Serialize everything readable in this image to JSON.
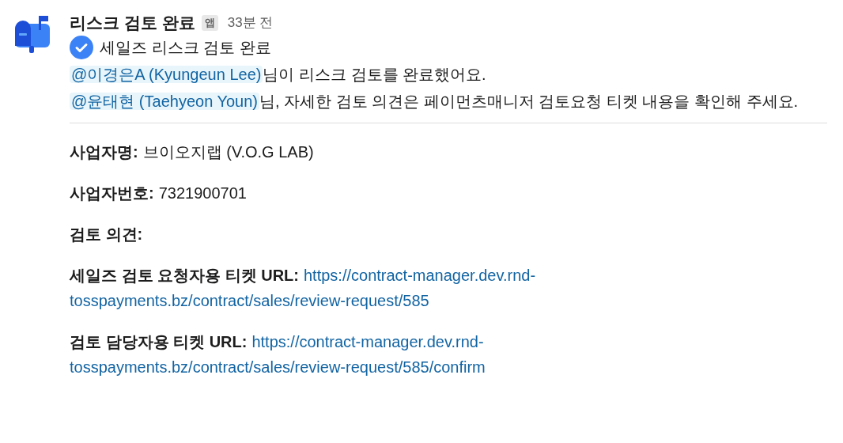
{
  "message": {
    "sender": "리스크 검토 완료",
    "badge": "앱",
    "time": "33분 전",
    "status": {
      "text": "세일즈 리스크 검토 완료"
    },
    "lines": [
      {
        "mention": "@이경은A (Kyungeun Lee)",
        "text": "님이 리스크 검토를 완료했어요."
      },
      {
        "mention": "@윤태현 (Taehyeon Youn)",
        "text": "님, 자세한 검토 의견은 페이먼츠매니저 검토요청 티켓 내용을 확인해 주세요."
      }
    ],
    "fields": [
      {
        "kind": "text",
        "label": "사업자명:",
        "value": "브이오지랩 (V.O.G LAB)"
      },
      {
        "kind": "text",
        "label": "사업자번호:",
        "value": "7321900701"
      },
      {
        "kind": "empty",
        "label": "검토 의견:"
      },
      {
        "kind": "link",
        "label": "세일즈 검토 요청자용 티켓 URL:",
        "value_lines": [
          "https://contract-manager.dev.rnd-",
          "tosspayments.bz/contract/sales/review-request/585"
        ]
      },
      {
        "kind": "link",
        "label": "검토 담당자용 티켓 URL:",
        "value_lines": [
          "https://contract-manager.dev.rnd-",
          "tosspayments.bz/contract/sales/review-request/585/confirm"
        ]
      }
    ]
  }
}
